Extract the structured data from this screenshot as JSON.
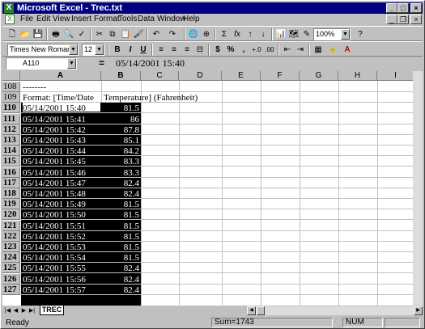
{
  "window": {
    "title": "Microsoft Excel - Trec.txt"
  },
  "menu": [
    "File",
    "Edit",
    "View",
    "Insert",
    "Format",
    "Tools",
    "Data",
    "Window",
    "Help"
  ],
  "toolbar": {
    "zoom": "100%",
    "font": "Times New Roman",
    "size": "12",
    "bold": "B",
    "italic": "I",
    "underline": "U",
    "currency": "$",
    "percent": "%",
    "comma": ",",
    "sum": "Σ",
    "fx": "fx"
  },
  "formula": {
    "name_box": "A110",
    "equals": "=",
    "content": "05/14/2001  15:40"
  },
  "columns": [
    "A",
    "B",
    "C",
    "D",
    "E",
    "F",
    "G",
    "H",
    "I"
  ],
  "rows": [
    {
      "num": "108",
      "a": "--------",
      "b": ""
    },
    {
      "num": "109",
      "a": "Format: [Time/Date",
      "b": "Temperature] (Fahrenheit)"
    },
    {
      "num": "110",
      "a": "05/14/2001  15:40",
      "b": "81.5"
    },
    {
      "num": "111",
      "a": "05/14/2001  15:41",
      "b": "86"
    },
    {
      "num": "112",
      "a": "05/14/2001  15:42",
      "b": "87.8"
    },
    {
      "num": "113",
      "a": "05/14/2001  15:43",
      "b": "85.1"
    },
    {
      "num": "114",
      "a": "05/14/2001  15:44",
      "b": "84.2"
    },
    {
      "num": "115",
      "a": "05/14/2001  15:45",
      "b": "83.3"
    },
    {
      "num": "116",
      "a": "05/14/2001  15:46",
      "b": "83.3"
    },
    {
      "num": "117",
      "a": "05/14/2001  15:47",
      "b": "82.4"
    },
    {
      "num": "118",
      "a": "05/14/2001  15:48",
      "b": "82.4"
    },
    {
      "num": "119",
      "a": "05/14/2001  15:49",
      "b": "81.5"
    },
    {
      "num": "120",
      "a": "05/14/2001  15:50",
      "b": "81.5"
    },
    {
      "num": "121",
      "a": "05/14/2001  15:51",
      "b": "81.5"
    },
    {
      "num": "122",
      "a": "05/14/2001  15:52",
      "b": "81.5"
    },
    {
      "num": "123",
      "a": "05/14/2001  15:53",
      "b": "81.5"
    },
    {
      "num": "124",
      "a": "05/14/2001  15:54",
      "b": "81.5"
    },
    {
      "num": "125",
      "a": "05/14/2001  15:55",
      "b": "82.4"
    },
    {
      "num": "126",
      "a": "05/14/2001  15:56",
      "b": "82.4"
    },
    {
      "num": "127",
      "a": "05/14/2001  15:57",
      "b": "82.4"
    }
  ],
  "sheet_tab": "TREC",
  "status": {
    "ready": "Ready",
    "sum": "Sum=1743",
    "num": "NUM"
  }
}
